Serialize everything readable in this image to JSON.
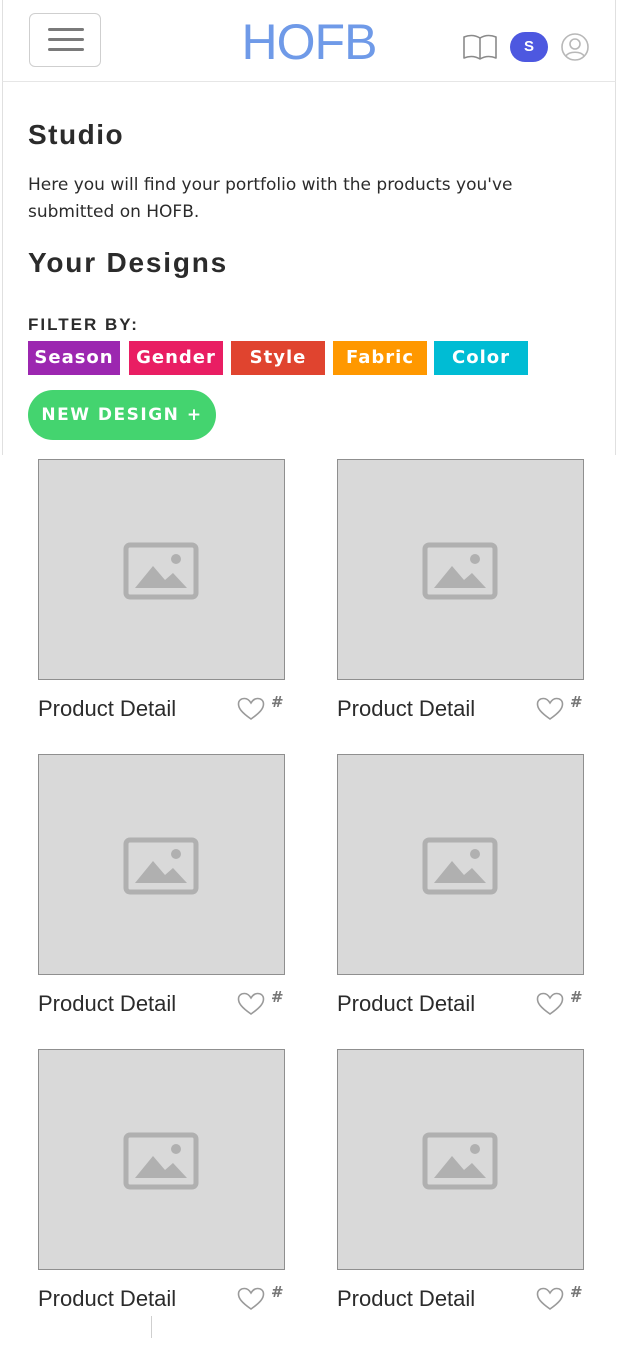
{
  "header": {
    "brand": "HOFB",
    "avatar_initial": "S"
  },
  "main": {
    "title": "Studio",
    "intro": "Here you will find your portfolio with the products you've submitted on HOFB.",
    "subtitle": "Your Designs",
    "filter_label": "FILTER BY:",
    "filters": [
      {
        "label": "Season",
        "color": "#9c27b0"
      },
      {
        "label": "Gender",
        "color": "#e91e63"
      },
      {
        "label": "Style",
        "color": "#e0442f"
      },
      {
        "label": "Fabric",
        "color": "#ff9800"
      },
      {
        "label": "Color",
        "color": "#00bcd4"
      }
    ],
    "new_design_label": "NEW DESIGN +"
  },
  "products": [
    {
      "label": "Product Detail",
      "count": "#"
    },
    {
      "label": "Product Detail",
      "count": "#"
    },
    {
      "label": "Product Detail",
      "count": "#"
    },
    {
      "label": "Product Detail",
      "count": "#"
    },
    {
      "label": "Product Detail",
      "count": "#"
    },
    {
      "label": "Product Detail",
      "count": "#"
    }
  ],
  "colors": {
    "brand": "#6f9ae8",
    "avatar": "#4d58e0",
    "new_design": "#44d46f",
    "placeholder": "#d9d9d9"
  }
}
